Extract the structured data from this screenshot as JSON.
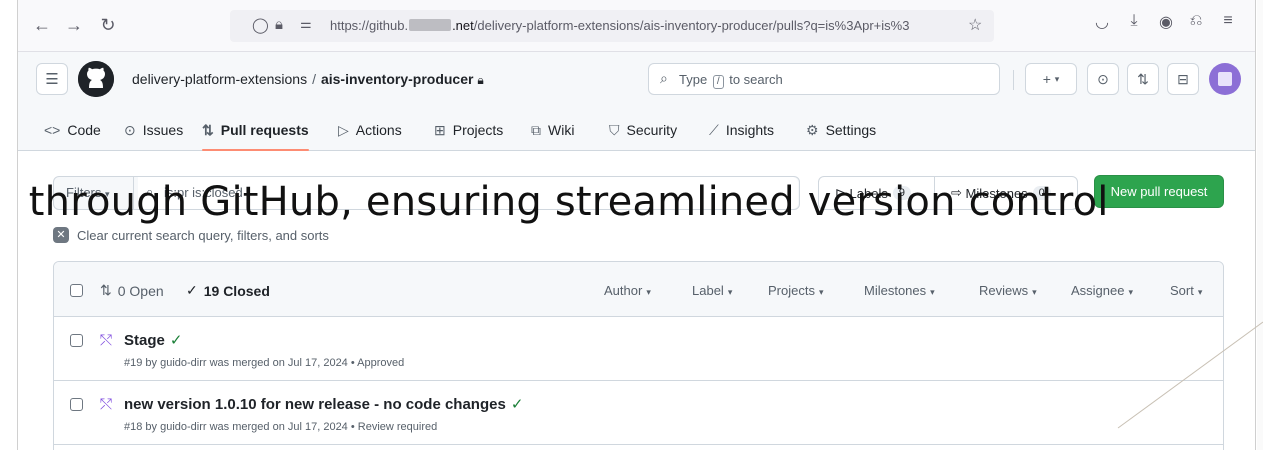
{
  "browser": {
    "url_prefix": "https://github.",
    "url_domain_suffix": ".net",
    "url_path": "/delivery-platform-extensions/ais-inventory-producer/pulls?q=is%3Apr+is%3"
  },
  "header": {
    "owner": "delivery-platform-extensions",
    "separator": "/",
    "repo": "ais-inventory-producer",
    "search_placeholder_before": "Type",
    "search_key": "/",
    "search_placeholder_after": "to search",
    "plus": "+"
  },
  "tabs": [
    {
      "label": "Code",
      "icon": "<>"
    },
    {
      "label": "Issues",
      "icon": "⊙"
    },
    {
      "label": "Pull requests",
      "icon": "⇅"
    },
    {
      "label": "Actions",
      "icon": "▷"
    },
    {
      "label": "Projects",
      "icon": "⊞"
    },
    {
      "label": "Wiki",
      "icon": "⧉"
    },
    {
      "label": "Security",
      "icon": "⛉"
    },
    {
      "label": "Insights",
      "icon": "⟋"
    },
    {
      "label": "Settings",
      "icon": "⚙"
    }
  ],
  "filters": {
    "button": "Filters",
    "query": "is:pr is:closed",
    "labels": "Labels",
    "labels_count": "9",
    "milestones": "Milestones",
    "milestones_count": "0",
    "new_pr": "New pull request",
    "clear": "Clear current search query, filters, and sorts"
  },
  "overlay_caption": "y through GitHub, ensuring streamlined version control",
  "list": {
    "open": "0 Open",
    "closed": "19 Closed",
    "columns": [
      "Author",
      "Label",
      "Projects",
      "Milestones",
      "Reviews",
      "Assignee",
      "Sort"
    ],
    "rows": [
      {
        "title": "Stage",
        "meta": "#19 by guido-dirr was merged on Jul 17, 2024 • Approved"
      },
      {
        "title": "new version 1.0.10 for new release - no code changes",
        "meta": "#18 by guido-dirr was merged on Jul 17, 2024 • Review required"
      }
    ]
  },
  "colors": {
    "accent_tab": "#fd8c73",
    "new_pr_button": "#2da44e",
    "merged_icon": "#8250df",
    "check": "#1a7f37"
  }
}
